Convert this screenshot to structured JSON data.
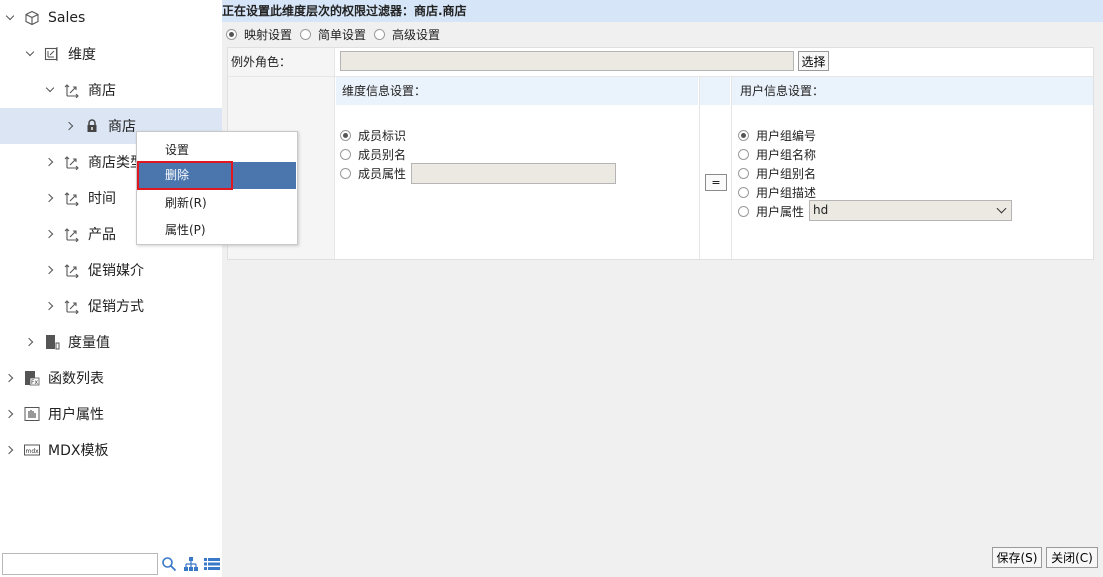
{
  "tree": {
    "items": [
      {
        "label": "Sales",
        "arrow": "down",
        "icon": "cube-icon"
      },
      {
        "label": "维度",
        "arrow": "down",
        "icon": "dimension-icon"
      },
      {
        "label": "商店",
        "arrow": "down",
        "icon": "hierarchy-icon"
      },
      {
        "label": "商店",
        "arrow": "right",
        "icon": "lock-icon"
      },
      {
        "label": "商店类型",
        "arrow": "right",
        "icon": "hierarchy-icon"
      },
      {
        "label": "时间",
        "arrow": "right",
        "icon": "hierarchy-icon"
      },
      {
        "label": "产品",
        "arrow": "right",
        "icon": "hierarchy-icon"
      },
      {
        "label": "促销媒介",
        "arrow": "right",
        "icon": "hierarchy-icon"
      },
      {
        "label": "促销方式",
        "arrow": "right",
        "icon": "hierarchy-icon"
      },
      {
        "label": "度量值",
        "arrow": "right",
        "icon": "measure-icon"
      },
      {
        "label": "函数列表",
        "arrow": "right",
        "icon": "function-icon"
      },
      {
        "label": "用户属性",
        "arrow": "right",
        "icon": "user-attribute-icon"
      },
      {
        "label": "MDX模板",
        "arrow": "right",
        "icon": "mdx-icon"
      }
    ]
  },
  "search": {
    "value": ""
  },
  "context_menu": {
    "items": [
      "设置",
      "删除",
      "刷新(R)",
      "属性(P)"
    ],
    "highlighted": "删除"
  },
  "panel": {
    "title": "正在设置此维度层次的权限过滤器：商店.商店",
    "modes": [
      "映射设置",
      "简单设置",
      "高级设置"
    ],
    "selected_mode": "映射设置",
    "exception_role_label": "例外角色：",
    "exception_role_value": "",
    "choose_button": "选择",
    "dimension_header": "维度信息设置：",
    "dimension_options": [
      "成员标识",
      "成员别名",
      "成员属性"
    ],
    "dimension_selected": "成员标识",
    "member_attr_value": "",
    "equals_button": "=",
    "user_header": "用户信息设置：",
    "user_options": [
      "用户组编号",
      "用户组名称",
      "用户组别名",
      "用户组描述",
      "用户属性"
    ],
    "user_selected": "用户组编号",
    "user_attr_value": "hd",
    "save_button": "保存(S)",
    "close_button": "关闭(C)"
  },
  "colors": {
    "title_bar": "#d6e6f8",
    "selected_row": "#dbe5f3",
    "menu_highlight": "#4a76ad",
    "menu_outline": "#e0171f"
  }
}
